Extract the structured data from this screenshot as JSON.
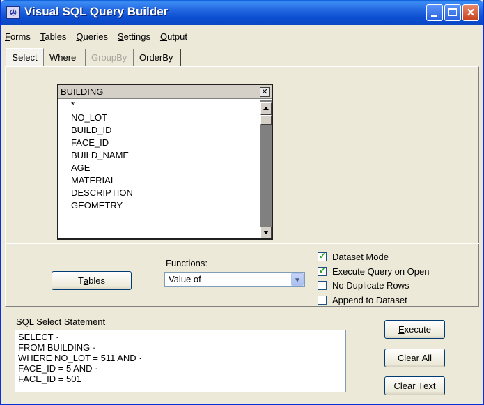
{
  "window": {
    "title": "Visual SQL Query Builder",
    "icon": "app-icon"
  },
  "menu": [
    {
      "pre": "",
      "ul": "F",
      "post": "orms"
    },
    {
      "pre": "",
      "ul": "T",
      "post": "ables"
    },
    {
      "pre": "",
      "ul": "Q",
      "post": "ueries"
    },
    {
      "pre": "",
      "ul": "S",
      "post": "ettings"
    },
    {
      "pre": "",
      "ul": "O",
      "post": "utput"
    }
  ],
  "tabs": [
    {
      "label": "Select",
      "active": true
    },
    {
      "label": "Where",
      "active": false
    },
    {
      "label": "GroupBy",
      "disabled": true
    },
    {
      "label": "OrderBy",
      "active": false
    }
  ],
  "table": {
    "name": "BUILDING",
    "fields": [
      "*",
      "NO_LOT",
      "BUILD_ID",
      "FACE_ID",
      "BUILD_NAME",
      "AGE",
      "MATERIAL",
      "DESCRIPTION",
      "GEOMETRY"
    ]
  },
  "buttons": {
    "tables": {
      "pre": "T",
      "ul": "a",
      "post": "bles"
    },
    "execute": {
      "pre": "",
      "ul": "E",
      "post": "xecute"
    },
    "clear_all": {
      "pre": "Clear ",
      "ul": "A",
      "post": "ll"
    },
    "clear_text": {
      "pre": "Clear ",
      "ul": "T",
      "post": "ext"
    }
  },
  "functions": {
    "label": "Functions:",
    "selected": "Value of"
  },
  "options": [
    {
      "label": "Dataset Mode",
      "checked": true
    },
    {
      "label": "Execute Query on Open",
      "checked": true
    },
    {
      "label": "No Duplicate Rows",
      "checked": false
    },
    {
      "label": "Append to Dataset",
      "checked": false
    }
  ],
  "sql": {
    "label": "SQL Select Statement",
    "lines": [
      "SELECT  ·",
      "FROM  BUILDING ·",
      "WHERE NO_LOT = 511 AND ·",
      "FACE_ID = 5 AND ·",
      "FACE_ID = 501"
    ]
  }
}
